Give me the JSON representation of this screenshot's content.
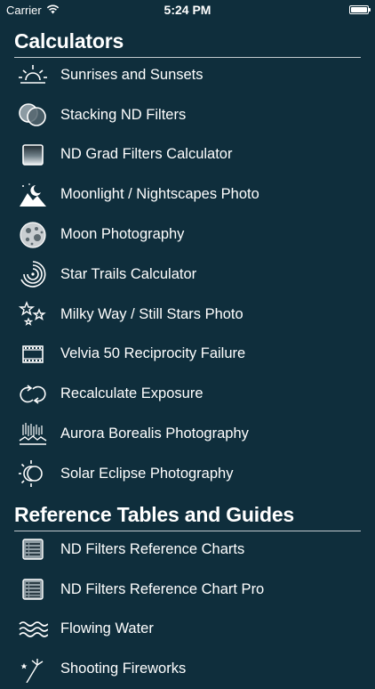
{
  "status_bar": {
    "carrier": "Carrier",
    "time": "5:24 PM"
  },
  "sections": [
    {
      "title": "Calculators",
      "items": [
        {
          "label": "Sunrises and Sunsets",
          "icon": "sunrise-icon"
        },
        {
          "label": "Stacking ND Filters",
          "icon": "stacked-filters-icon"
        },
        {
          "label": "ND Grad Filters Calculator",
          "icon": "gradient-filter-icon"
        },
        {
          "label": "Moonlight / Nightscapes Photo",
          "icon": "moon-mountain-icon"
        },
        {
          "label": "Moon Photography",
          "icon": "moon-icon"
        },
        {
          "label": "Star Trails Calculator",
          "icon": "star-trails-icon"
        },
        {
          "label": "Milky Way / Still Stars Photo",
          "icon": "stars-icon"
        },
        {
          "label": "Velvia 50 Reciprocity Failure",
          "icon": "film-icon"
        },
        {
          "label": "Recalculate Exposure",
          "icon": "recalculate-icon"
        },
        {
          "label": "Aurora Borealis Photography",
          "icon": "aurora-icon"
        },
        {
          "label": "Solar Eclipse Photography",
          "icon": "eclipse-icon"
        }
      ]
    },
    {
      "title": "Reference Tables and Guides",
      "items": [
        {
          "label": "ND Filters Reference Charts",
          "icon": "reference-chart-icon"
        },
        {
          "label": "ND Filters Reference Chart Pro",
          "icon": "reference-chart-pro-icon"
        },
        {
          "label": "Flowing Water",
          "icon": "water-icon"
        },
        {
          "label": "Shooting Fireworks",
          "icon": "fireworks-icon"
        }
      ]
    }
  ]
}
